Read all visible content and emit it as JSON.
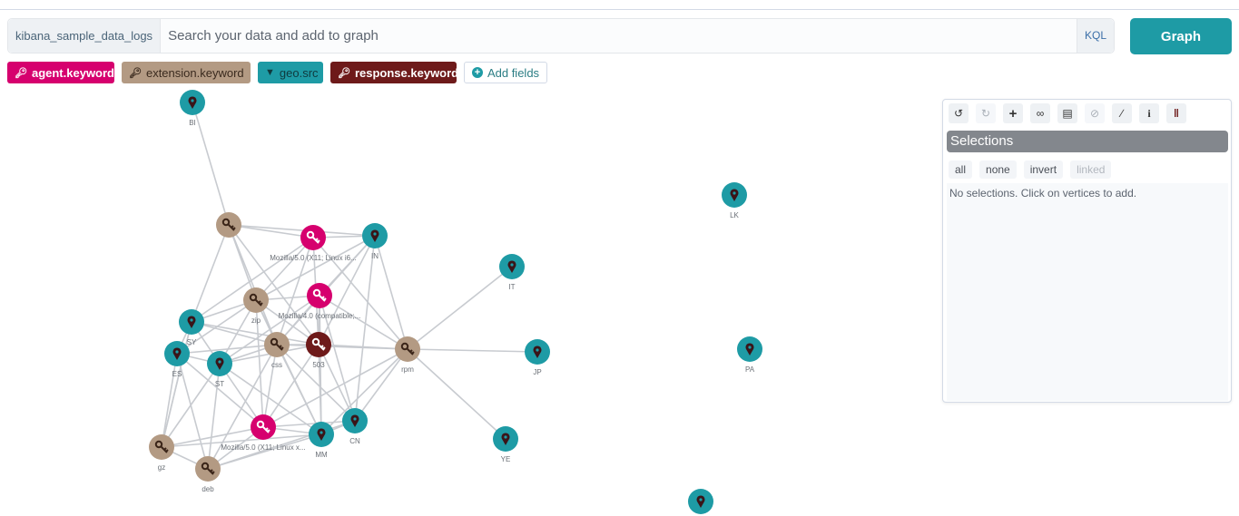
{
  "search": {
    "index_label": "kibana_sample_data_logs",
    "placeholder": "Search your data and add to graph",
    "value": "",
    "kql_label": "KQL",
    "graph_button": "Graph"
  },
  "fields": [
    {
      "label": "agent.keyword",
      "color": "#d6006e",
      "icon": "key-icon"
    },
    {
      "label": "extension.keyword",
      "color": "#b39a83",
      "icon": "key-icon"
    },
    {
      "label": "geo.src",
      "color": "#1e9ba5",
      "icon": "map-marker-icon"
    },
    {
      "label": "response.keyword",
      "color": "#6e1a1a",
      "icon": "key-icon"
    }
  ],
  "add_fields_label": "Add fields",
  "panel": {
    "tools": [
      "undo-icon",
      "redo-icon",
      "expand-icon",
      "link-icon",
      "delete-icon",
      "blocklist-icon",
      "style-icon",
      "info-icon",
      "pause-icon"
    ],
    "selections_title": "Selections",
    "buttons": [
      "all",
      "none",
      "invert",
      "linked"
    ],
    "empty_message": "No selections. Click on vertices to add."
  },
  "colors": {
    "agent": "#d6006e",
    "extension": "#b39a83",
    "geo": "#1e9ba5",
    "response": "#6e1a1a",
    "edge": "#c8cbd0"
  },
  "vertices": [
    {
      "id": "BI",
      "type": "geo",
      "label": "BI"
    },
    {
      "id": "ext1",
      "type": "extension",
      "label": ""
    },
    {
      "id": "moz1",
      "type": "agent",
      "label": "Mozilla/5.0 (X11; Linux i6..."
    },
    {
      "id": "IN",
      "type": "geo",
      "label": "IN"
    },
    {
      "id": "IT",
      "type": "geo",
      "label": "IT"
    },
    {
      "id": "LK",
      "type": "geo",
      "label": "LK"
    },
    {
      "id": "zip",
      "type": "extension",
      "label": "zip"
    },
    {
      "id": "moz2",
      "type": "agent",
      "label": "Mozilla/4.0 (compatible;..."
    },
    {
      "id": "SY",
      "type": "geo",
      "label": "SY"
    },
    {
      "id": "ES",
      "type": "geo",
      "label": "ES"
    },
    {
      "id": "ST",
      "type": "geo",
      "label": "ST"
    },
    {
      "id": "css",
      "type": "extension",
      "label": "css"
    },
    {
      "id": "503",
      "type": "response",
      "label": "503"
    },
    {
      "id": "rpm",
      "type": "extension",
      "label": "rpm"
    },
    {
      "id": "JP",
      "type": "geo",
      "label": "JP"
    },
    {
      "id": "PA",
      "type": "geo",
      "label": "PA"
    },
    {
      "id": "moz3",
      "type": "agent",
      "label": "Mozilla/5.0 (X11; Linux x..."
    },
    {
      "id": "MM",
      "type": "geo",
      "label": "MM"
    },
    {
      "id": "CN",
      "type": "geo",
      "label": "CN"
    },
    {
      "id": "YE",
      "type": "geo",
      "label": "YE"
    },
    {
      "id": "gz",
      "type": "extension",
      "label": "gz"
    },
    {
      "id": "deb",
      "type": "extension",
      "label": "deb"
    },
    {
      "id": "geo_bottom",
      "type": "geo",
      "label": ""
    }
  ],
  "edges": [
    [
      "BI",
      "ext1"
    ],
    [
      "ext1",
      "moz1"
    ],
    [
      "ext1",
      "IN"
    ],
    [
      "ext1",
      "zip"
    ],
    [
      "ext1",
      "SY"
    ],
    [
      "ext1",
      "css"
    ],
    [
      "ext1",
      "503"
    ],
    [
      "moz1",
      "IN"
    ],
    [
      "moz1",
      "zip"
    ],
    [
      "moz1",
      "503"
    ],
    [
      "moz1",
      "css"
    ],
    [
      "moz1",
      "rpm"
    ],
    [
      "moz1",
      "SY"
    ],
    [
      "IN",
      "zip"
    ],
    [
      "IN",
      "css"
    ],
    [
      "IN",
      "503"
    ],
    [
      "IN",
      "rpm"
    ],
    [
      "IN",
      "CN"
    ],
    [
      "IN",
      "moz2"
    ],
    [
      "IT",
      "rpm"
    ],
    [
      "zip",
      "moz2"
    ],
    [
      "zip",
      "SY"
    ],
    [
      "zip",
      "ES"
    ],
    [
      "zip",
      "ST"
    ],
    [
      "zip",
      "css"
    ],
    [
      "zip",
      "503"
    ],
    [
      "zip",
      "moz3"
    ],
    [
      "zip",
      "MM"
    ],
    [
      "moz2",
      "css"
    ],
    [
      "moz2",
      "503"
    ],
    [
      "moz2",
      "rpm"
    ],
    [
      "moz2",
      "ST"
    ],
    [
      "moz2",
      "CN"
    ],
    [
      "moz2",
      "MM"
    ],
    [
      "SY",
      "ES"
    ],
    [
      "SY",
      "ST"
    ],
    [
      "SY",
      "css"
    ],
    [
      "SY",
      "503"
    ],
    [
      "SY",
      "gz"
    ],
    [
      "ES",
      "ST"
    ],
    [
      "ES",
      "css"
    ],
    [
      "ES",
      "gz"
    ],
    [
      "ES",
      "deb"
    ],
    [
      "ES",
      "moz3"
    ],
    [
      "ST",
      "css"
    ],
    [
      "ST",
      "503"
    ],
    [
      "ST",
      "moz3"
    ],
    [
      "ST",
      "gz"
    ],
    [
      "ST",
      "deb"
    ],
    [
      "ST",
      "MM"
    ],
    [
      "css",
      "503"
    ],
    [
      "css",
      "moz3"
    ],
    [
      "css",
      "MM"
    ],
    [
      "css",
      "CN"
    ],
    [
      "css",
      "rpm"
    ],
    [
      "css",
      "deb"
    ],
    [
      "503",
      "rpm"
    ],
    [
      "503",
      "moz3"
    ],
    [
      "503",
      "MM"
    ],
    [
      "503",
      "CN"
    ],
    [
      "rpm",
      "JP"
    ],
    [
      "rpm",
      "YE"
    ],
    [
      "rpm",
      "CN"
    ],
    [
      "rpm",
      "MM"
    ],
    [
      "rpm",
      "moz3"
    ],
    [
      "moz3",
      "MM"
    ],
    [
      "moz3",
      "CN"
    ],
    [
      "moz3",
      "gz"
    ],
    [
      "moz3",
      "deb"
    ],
    [
      "MM",
      "CN"
    ],
    [
      "MM",
      "deb"
    ],
    [
      "MM",
      "gz"
    ],
    [
      "CN",
      "deb"
    ],
    [
      "gz",
      "deb"
    ],
    [
      "gz",
      "SY"
    ]
  ]
}
